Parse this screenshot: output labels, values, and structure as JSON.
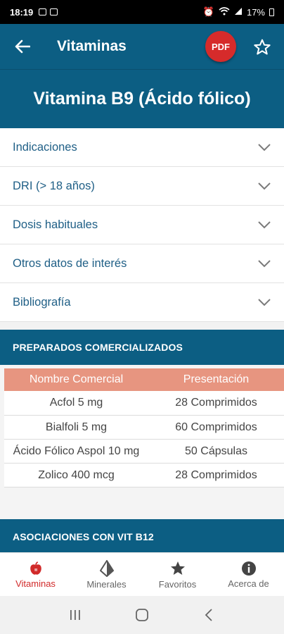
{
  "status_bar": {
    "time": "18:19",
    "battery": "17%"
  },
  "app_bar": {
    "title": "Vitaminas",
    "pdf_label": "PDF"
  },
  "page_title": "Vitamina B9 (Ácido fólico)",
  "accordion": [
    {
      "label": "Indicaciones"
    },
    {
      "label": "DRI (> 18 años)"
    },
    {
      "label": "Dosis habituales"
    },
    {
      "label": "Otros datos de interés"
    },
    {
      "label": "Bibliografía"
    }
  ],
  "preparados": {
    "header": "PREPARADOS COMERCIALIZADOS",
    "columns": [
      "Nombre Comercial",
      "Presentación"
    ],
    "rows": [
      [
        "Acfol 5 mg",
        "28 Comprimidos"
      ],
      [
        "Bialfoli 5 mg",
        "60 Comprimidos"
      ],
      [
        "Ácido Fólico Aspol 10 mg",
        "50 Cápsulas"
      ],
      [
        "Zolico 400 mcg",
        "28 Comprimidos"
      ]
    ]
  },
  "asociaciones": {
    "header": "ASOCIACIONES CON VIT B12"
  },
  "bottom_nav": [
    {
      "label": "Vitaminas",
      "icon": "apple-icon",
      "active": true
    },
    {
      "label": "Minerales",
      "icon": "crystal-icon",
      "active": false
    },
    {
      "label": "Favoritos",
      "icon": "star-icon",
      "active": false
    },
    {
      "label": "Acerca de",
      "icon": "info-icon",
      "active": false
    }
  ],
  "colors": {
    "primary": "#0c5e83",
    "pdf_red": "#d62b2b",
    "table_header": "#e79580",
    "active_nav": "#d12a2a",
    "link_text": "#1f5f86"
  }
}
